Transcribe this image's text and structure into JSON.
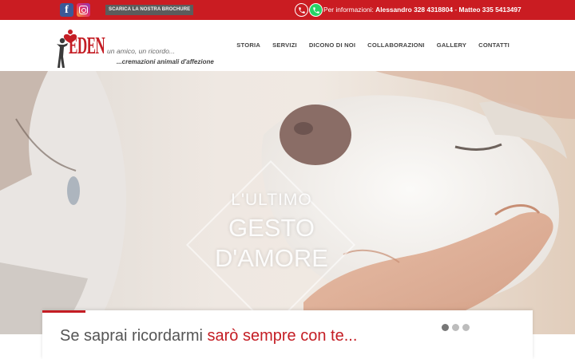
{
  "topbar": {
    "facebook_icon": "facebook-icon",
    "instagram_icon": "instagram-icon",
    "brochure_label": "SCARICA LA NOSTRA BROCHURE",
    "phone_icon": "phone-icon",
    "whatsapp_icon": "whatsapp-icon",
    "contact_prefix": "Per informazioni:",
    "contact_alessandro": "Alessandro 328 4318804",
    "contact_separator": " - ",
    "contact_matteo": "Matteo 335 5413497",
    "accent_color": "#ca1c22"
  },
  "header": {
    "logo_text": "EDEN",
    "tagline_1": "un amico, un ricordo...",
    "tagline_2": "...cremazioni animali d'affezione",
    "nav": [
      {
        "label": "STORIA"
      },
      {
        "label": "SERVIZI"
      },
      {
        "label": "DICONO DI NOI"
      },
      {
        "label": "COLLABORAZIONI"
      },
      {
        "label": "GALLERY"
      },
      {
        "label": "CONTATTI"
      }
    ]
  },
  "hero": {
    "line_1": "L'ULTIMO",
    "line_2": "GESTO",
    "line_3": "D'AMORE"
  },
  "caption": {
    "text_plain": "Se saprai ricordarmi ",
    "text_highlight": "sarò sempre con te...",
    "highlight_color": "#c41d24",
    "slides_total": 3,
    "slide_active": 1
  }
}
